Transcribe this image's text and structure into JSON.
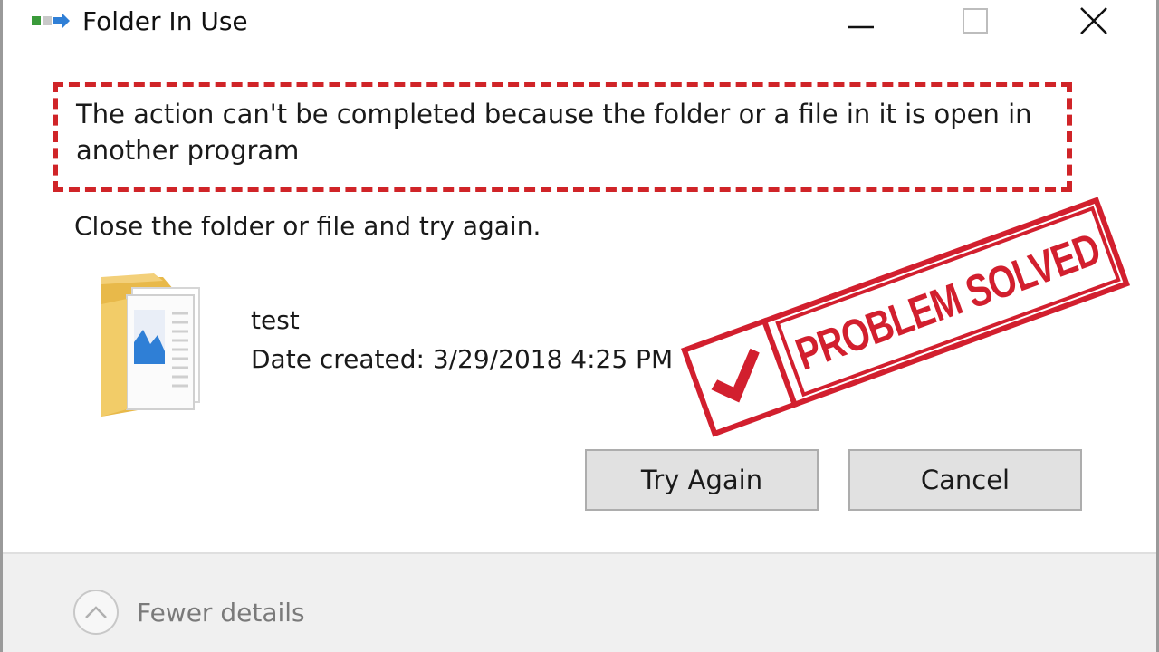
{
  "window": {
    "title": "Folder In Use"
  },
  "dialog": {
    "message": "The action can't be completed because the folder or a file in it is open in another program",
    "instruction": "Close the folder or file and try again."
  },
  "file": {
    "name": "test",
    "date_created": "Date created: 3/29/2018 4:25 PM"
  },
  "stamp": {
    "label": "PROBLEM SOLVED",
    "color": "#d21f2e"
  },
  "buttons": {
    "try_again": "Try Again",
    "cancel": "Cancel"
  },
  "footer": {
    "details_toggle": "Fewer details"
  },
  "icons": {
    "app": "folder-in-use-icon",
    "minimize": "minimize-icon",
    "maximize": "maximize-icon",
    "close": "close-icon",
    "folder": "folder-icon",
    "check": "checkmark-icon",
    "chevron": "chevron-up-icon"
  },
  "colors": {
    "highlight": "#d02428",
    "button_bg": "#e1e1e1",
    "footer_bg": "#f0f0f0"
  }
}
